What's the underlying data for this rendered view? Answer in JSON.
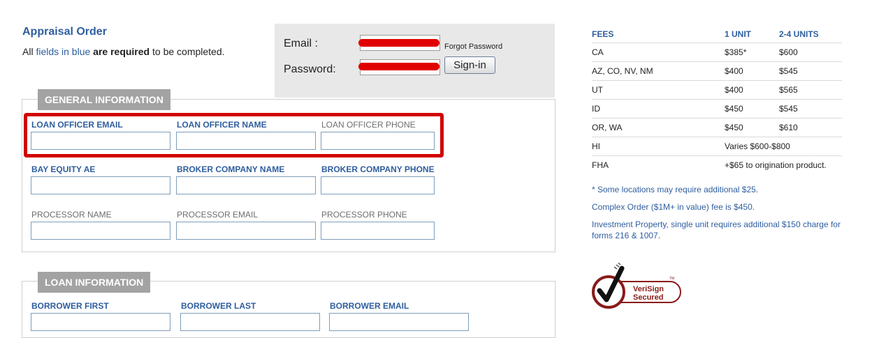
{
  "page": {
    "title": "Appraisal Order",
    "req_part1": "All ",
    "req_part2": "fields in blue",
    "req_part3": " are required",
    "req_part4": " to be completed."
  },
  "login": {
    "email_label": "Email :",
    "password_label": "Password:",
    "forgot_label": "Forgot Password",
    "signin_label": "Sign-in"
  },
  "general": {
    "legend": "GENERAL INFORMATION",
    "fields": [
      {
        "label": "LOAN OFFICER EMAIL",
        "required": true
      },
      {
        "label": "LOAN OFFICER NAME",
        "required": true
      },
      {
        "label": "LOAN OFFICER PHONE",
        "required": false
      },
      {
        "label": "BAY EQUITY AE",
        "required": true
      },
      {
        "label": "BROKER COMPANY NAME",
        "required": true
      },
      {
        "label": "BROKER COMPANY PHONE",
        "required": true
      },
      {
        "label": "PROCESSOR NAME",
        "required": false
      },
      {
        "label": "PROCESSOR EMAIL",
        "required": false
      },
      {
        "label": "PROCESSOR PHONE",
        "required": false
      }
    ]
  },
  "loan": {
    "legend": "LOAN INFORMATION",
    "fields": [
      {
        "label": "BORROWER FIRST",
        "required": true
      },
      {
        "label": "BORROWER LAST",
        "required": true
      },
      {
        "label": "BORROWER EMAIL",
        "required": true
      }
    ]
  },
  "fees": {
    "headers": [
      "FEES",
      "1 UNIT",
      "2-4 UNITS"
    ],
    "rows": [
      [
        "CA",
        "$385*",
        "$600"
      ],
      [
        "AZ, CO, NV, NM",
        "$400",
        "$545"
      ],
      [
        "UT",
        "$400",
        "$565"
      ],
      [
        "ID",
        "$450",
        "$545"
      ],
      [
        "OR, WA",
        "$450",
        "$610"
      ],
      [
        "HI",
        "Varies $600-$800"
      ],
      [
        "FHA",
        "+$65 to origination product."
      ]
    ],
    "notes": [
      "* Some locations may require additional $25.",
      "Complex Order ($1M+ in value) fee is $450.",
      "Investment Property, single unit requires additional $150 charge for forms 216 & 1007."
    ]
  },
  "seal": {
    "line1": "VeriSign",
    "line2": "Secured",
    "tm": "TM"
  },
  "colors": {
    "accent": "#2f5e9e",
    "legend_bg": "#a3a3a3",
    "highlight": "#d10000",
    "redaction": "#e00000"
  }
}
